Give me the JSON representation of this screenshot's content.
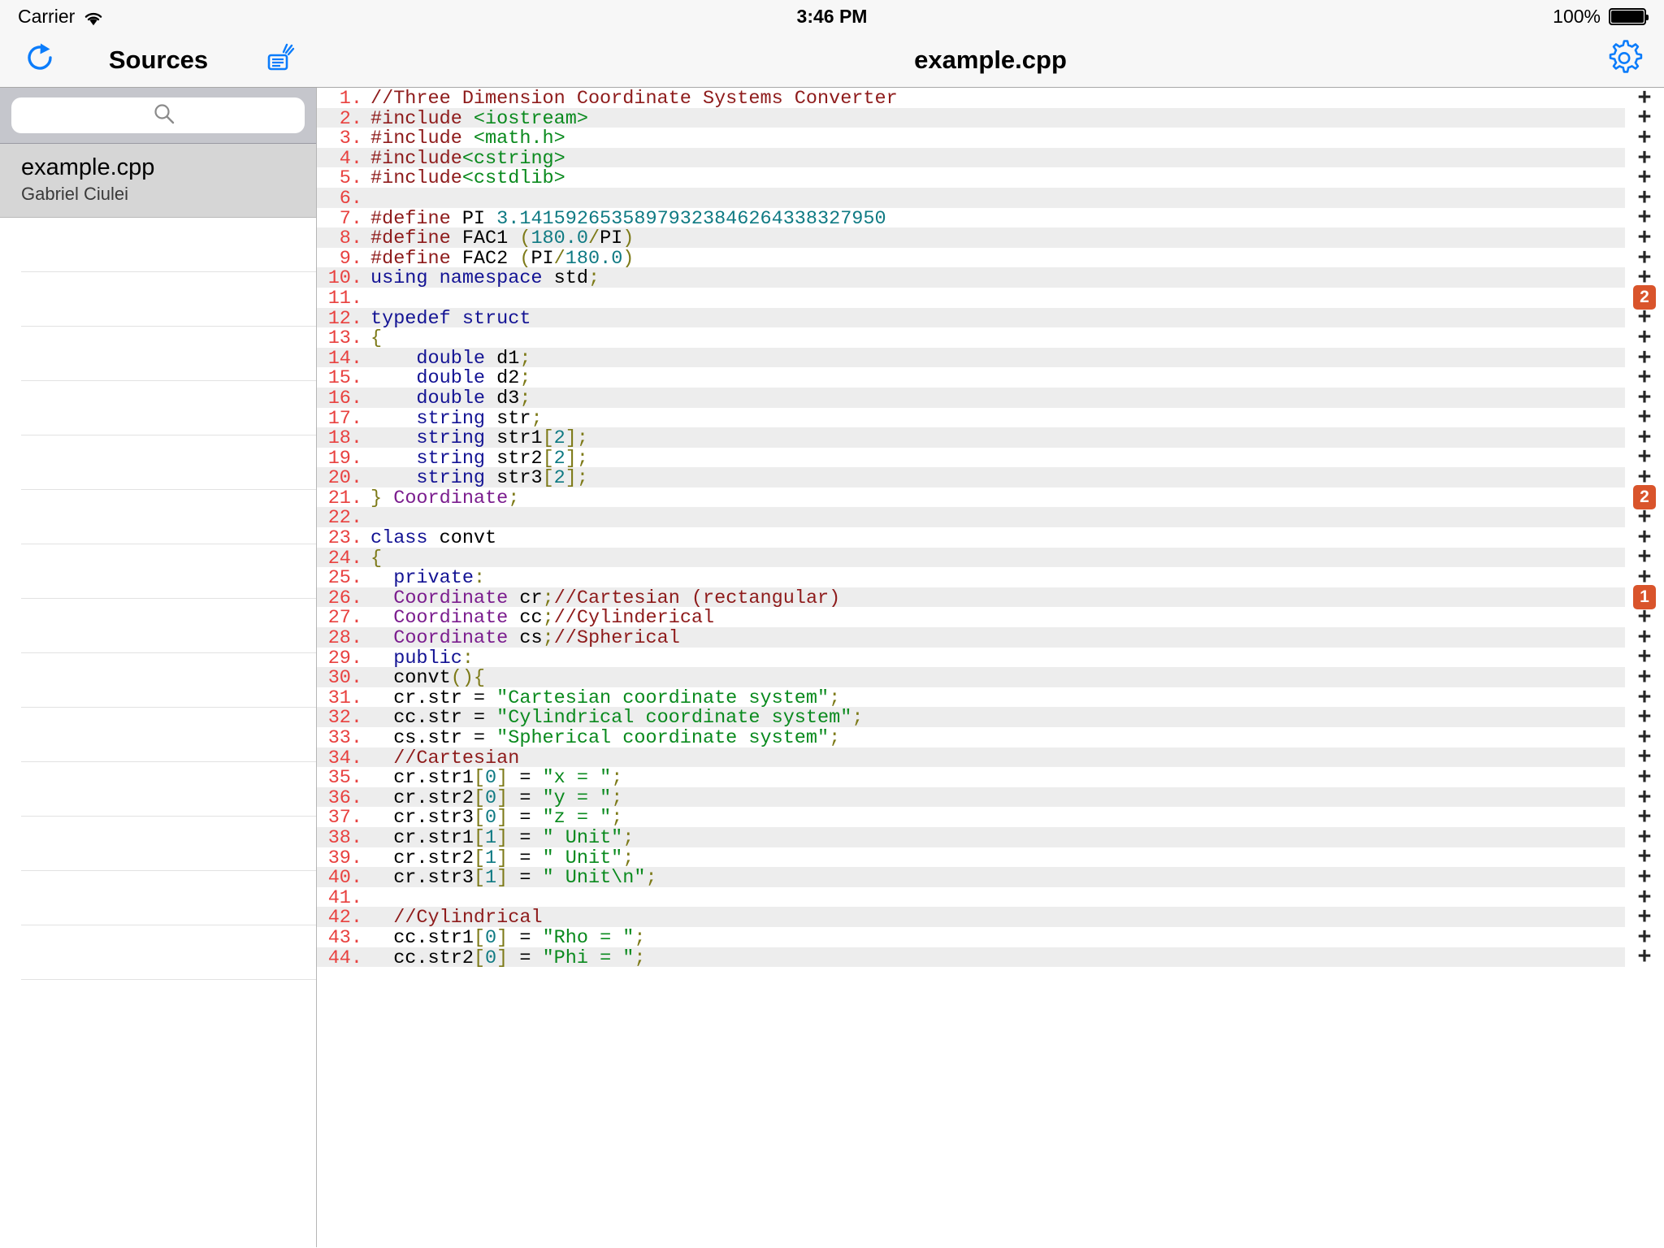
{
  "statusbar": {
    "carrier": "Carrier",
    "wifi_icon": "wifi-icon",
    "time": "3:46 PM",
    "battery_pct": "100%",
    "battery_icon": "battery-icon"
  },
  "navbar": {
    "refresh_icon": "refresh-icon",
    "sidebar_title": "Sources",
    "share_icon": "share-icon",
    "document_title": "example.cpp",
    "gear_icon": "gear-icon"
  },
  "sidebar": {
    "search": {
      "value": "",
      "placeholder": "",
      "icon": "search-icon"
    },
    "files": [
      {
        "name": "example.cpp",
        "author": "Gabriel Ciulei",
        "selected": true
      }
    ],
    "empty_row_count": 14
  },
  "editor": {
    "gutter_plus": "+",
    "badges": {
      "11": "2",
      "21": "2",
      "26": "1"
    },
    "lines": [
      {
        "n": "1.",
        "tokens": [
          [
            "cmt",
            "//Three Dimension Coordinate Systems Converter"
          ]
        ]
      },
      {
        "n": "2.",
        "tokens": [
          [
            "pre",
            "#include "
          ],
          [
            "str",
            "<iostream>"
          ]
        ]
      },
      {
        "n": "3.",
        "tokens": [
          [
            "pre",
            "#include "
          ],
          [
            "str",
            "<math.h>"
          ]
        ]
      },
      {
        "n": "4.",
        "tokens": [
          [
            "pre",
            "#include"
          ],
          [
            "str",
            "<cstring>"
          ]
        ]
      },
      {
        "n": "5.",
        "tokens": [
          [
            "pre",
            "#include"
          ],
          [
            "str",
            "<cstdlib>"
          ]
        ]
      },
      {
        "n": "6.",
        "tokens": []
      },
      {
        "n": "7.",
        "tokens": [
          [
            "pre",
            "#define "
          ],
          [
            "id",
            "PI "
          ],
          [
            "num",
            "3.14159265358979323846264338327950"
          ]
        ]
      },
      {
        "n": "8.",
        "tokens": [
          [
            "pre",
            "#define "
          ],
          [
            "id",
            "FAC1 "
          ],
          [
            "pun",
            "("
          ],
          [
            "num",
            "180.0"
          ],
          [
            "pun",
            "/"
          ],
          [
            "id",
            "PI"
          ],
          [
            "pun",
            ")"
          ]
        ]
      },
      {
        "n": "9.",
        "tokens": [
          [
            "pre",
            "#define "
          ],
          [
            "id",
            "FAC2 "
          ],
          [
            "pun",
            "("
          ],
          [
            "id",
            "PI"
          ],
          [
            "pun",
            "/"
          ],
          [
            "num",
            "180.0"
          ],
          [
            "pun",
            ")"
          ]
        ]
      },
      {
        "n": "10.",
        "tokens": [
          [
            "kw",
            "using namespace "
          ],
          [
            "id",
            "std"
          ],
          [
            "pun",
            ";"
          ]
        ]
      },
      {
        "n": "11.",
        "tokens": []
      },
      {
        "n": "12.",
        "tokens": [
          [
            "kw",
            "typedef struct"
          ]
        ]
      },
      {
        "n": "13.",
        "tokens": [
          [
            "pun",
            "{"
          ]
        ]
      },
      {
        "n": "14.",
        "tokens": [
          [
            "id",
            "    "
          ],
          [
            "kw",
            "double "
          ],
          [
            "id",
            "d1"
          ],
          [
            "pun",
            ";"
          ]
        ]
      },
      {
        "n": "15.",
        "tokens": [
          [
            "id",
            "    "
          ],
          [
            "kw",
            "double "
          ],
          [
            "id",
            "d2"
          ],
          [
            "pun",
            ";"
          ]
        ]
      },
      {
        "n": "16.",
        "tokens": [
          [
            "id",
            "    "
          ],
          [
            "kw",
            "double "
          ],
          [
            "id",
            "d3"
          ],
          [
            "pun",
            ";"
          ]
        ]
      },
      {
        "n": "17.",
        "tokens": [
          [
            "id",
            "    "
          ],
          [
            "kw",
            "string "
          ],
          [
            "id",
            "str"
          ],
          [
            "pun",
            ";"
          ]
        ]
      },
      {
        "n": "18.",
        "tokens": [
          [
            "id",
            "    "
          ],
          [
            "kw",
            "string "
          ],
          [
            "id",
            "str1"
          ],
          [
            "pun",
            "["
          ],
          [
            "num",
            "2"
          ],
          [
            "pun",
            "];"
          ]
        ]
      },
      {
        "n": "19.",
        "tokens": [
          [
            "id",
            "    "
          ],
          [
            "kw",
            "string "
          ],
          [
            "id",
            "str2"
          ],
          [
            "pun",
            "["
          ],
          [
            "num",
            "2"
          ],
          [
            "pun",
            "];"
          ]
        ]
      },
      {
        "n": "20.",
        "tokens": [
          [
            "id",
            "    "
          ],
          [
            "kw",
            "string "
          ],
          [
            "id",
            "str3"
          ],
          [
            "pun",
            "["
          ],
          [
            "num",
            "2"
          ],
          [
            "pun",
            "];"
          ]
        ]
      },
      {
        "n": "21.",
        "tokens": [
          [
            "pun",
            "} "
          ],
          [
            "type",
            "Coordinate"
          ],
          [
            "pun",
            ";"
          ]
        ]
      },
      {
        "n": "22.",
        "tokens": []
      },
      {
        "n": "23.",
        "tokens": [
          [
            "kw",
            "class "
          ],
          [
            "id",
            "convt"
          ]
        ]
      },
      {
        "n": "24.",
        "tokens": [
          [
            "pun",
            "{"
          ]
        ]
      },
      {
        "n": "25.",
        "tokens": [
          [
            "id",
            "  "
          ],
          [
            "kw",
            "private"
          ],
          [
            "pun",
            ":"
          ]
        ]
      },
      {
        "n": "26.",
        "tokens": [
          [
            "id",
            "  "
          ],
          [
            "type",
            "Coordinate "
          ],
          [
            "id",
            "cr"
          ],
          [
            "pun",
            ";"
          ],
          [
            "cmt",
            "//Cartesian (rectangular)"
          ]
        ]
      },
      {
        "n": "27.",
        "tokens": [
          [
            "id",
            "  "
          ],
          [
            "type",
            "Coordinate "
          ],
          [
            "id",
            "cc"
          ],
          [
            "pun",
            ";"
          ],
          [
            "cmt",
            "//Cylinderical"
          ]
        ]
      },
      {
        "n": "28.",
        "tokens": [
          [
            "id",
            "  "
          ],
          [
            "type",
            "Coordinate "
          ],
          [
            "id",
            "cs"
          ],
          [
            "pun",
            ";"
          ],
          [
            "cmt",
            "//Spherical"
          ]
        ]
      },
      {
        "n": "29.",
        "tokens": [
          [
            "id",
            "  "
          ],
          [
            "kw",
            "public"
          ],
          [
            "pun",
            ":"
          ]
        ]
      },
      {
        "n": "30.",
        "tokens": [
          [
            "id",
            "  convt"
          ],
          [
            "pun",
            "(){"
          ]
        ]
      },
      {
        "n": "31.",
        "tokens": [
          [
            "id",
            "  cr.str = "
          ],
          [
            "str",
            "\"Cartesian coordinate system\""
          ],
          [
            "pun",
            ";"
          ]
        ]
      },
      {
        "n": "32.",
        "tokens": [
          [
            "id",
            "  cc.str = "
          ],
          [
            "str",
            "\"Cylindrical coordinate system\""
          ],
          [
            "pun",
            ";"
          ]
        ]
      },
      {
        "n": "33.",
        "tokens": [
          [
            "id",
            "  cs.str = "
          ],
          [
            "str",
            "\"Spherical coordinate system\""
          ],
          [
            "pun",
            ";"
          ]
        ]
      },
      {
        "n": "34.",
        "tokens": [
          [
            "id",
            "  "
          ],
          [
            "cmt",
            "//Cartesian"
          ]
        ]
      },
      {
        "n": "35.",
        "tokens": [
          [
            "id",
            "  cr.str1"
          ],
          [
            "pun",
            "["
          ],
          [
            "num",
            "0"
          ],
          [
            "pun",
            "]"
          ],
          [
            "id",
            " = "
          ],
          [
            "str",
            "\"x = \""
          ],
          [
            "pun",
            ";"
          ]
        ]
      },
      {
        "n": "36.",
        "tokens": [
          [
            "id",
            "  cr.str2"
          ],
          [
            "pun",
            "["
          ],
          [
            "num",
            "0"
          ],
          [
            "pun",
            "]"
          ],
          [
            "id",
            " = "
          ],
          [
            "str",
            "\"y = \""
          ],
          [
            "pun",
            ";"
          ]
        ]
      },
      {
        "n": "37.",
        "tokens": [
          [
            "id",
            "  cr.str3"
          ],
          [
            "pun",
            "["
          ],
          [
            "num",
            "0"
          ],
          [
            "pun",
            "]"
          ],
          [
            "id",
            " = "
          ],
          [
            "str",
            "\"z = \""
          ],
          [
            "pun",
            ";"
          ]
        ]
      },
      {
        "n": "38.",
        "tokens": [
          [
            "id",
            "  cr.str1"
          ],
          [
            "pun",
            "["
          ],
          [
            "num",
            "1"
          ],
          [
            "pun",
            "]"
          ],
          [
            "id",
            " = "
          ],
          [
            "str",
            "\" Unit\""
          ],
          [
            "pun",
            ";"
          ]
        ]
      },
      {
        "n": "39.",
        "tokens": [
          [
            "id",
            "  cr.str2"
          ],
          [
            "pun",
            "["
          ],
          [
            "num",
            "1"
          ],
          [
            "pun",
            "]"
          ],
          [
            "id",
            " = "
          ],
          [
            "str",
            "\" Unit\""
          ],
          [
            "pun",
            ";"
          ]
        ]
      },
      {
        "n": "40.",
        "tokens": [
          [
            "id",
            "  cr.str3"
          ],
          [
            "pun",
            "["
          ],
          [
            "num",
            "1"
          ],
          [
            "pun",
            "]"
          ],
          [
            "id",
            " = "
          ],
          [
            "str",
            "\" Unit\\n\""
          ],
          [
            "pun",
            ";"
          ]
        ]
      },
      {
        "n": "41.",
        "tokens": []
      },
      {
        "n": "42.",
        "tokens": [
          [
            "id",
            "  "
          ],
          [
            "cmt",
            "//Cylindrical"
          ]
        ]
      },
      {
        "n": "43.",
        "tokens": [
          [
            "id",
            "  cc.str1"
          ],
          [
            "pun",
            "["
          ],
          [
            "num",
            "0"
          ],
          [
            "pun",
            "]"
          ],
          [
            "id",
            " = "
          ],
          [
            "str",
            "\"Rho = \""
          ],
          [
            "pun",
            ";"
          ]
        ]
      },
      {
        "n": "44.",
        "tokens": [
          [
            "id",
            "  cc.str2"
          ],
          [
            "pun",
            "["
          ],
          [
            "num",
            "0"
          ],
          [
            "pun",
            "]"
          ],
          [
            "id",
            " = "
          ],
          [
            "str",
            "\"Phi = \""
          ],
          [
            "pun",
            ";"
          ]
        ]
      }
    ]
  },
  "colors": {
    "accent_blue": "#0b7cfb",
    "badge_orange": "#d9542b",
    "lineno_red": "#e8413f",
    "comment": "#8e1b1b",
    "string": "#0a8a1e",
    "keyword": "#131394",
    "type": "#7b1d8e",
    "number": "#0f7a83",
    "punctuation": "#7d7a18"
  }
}
